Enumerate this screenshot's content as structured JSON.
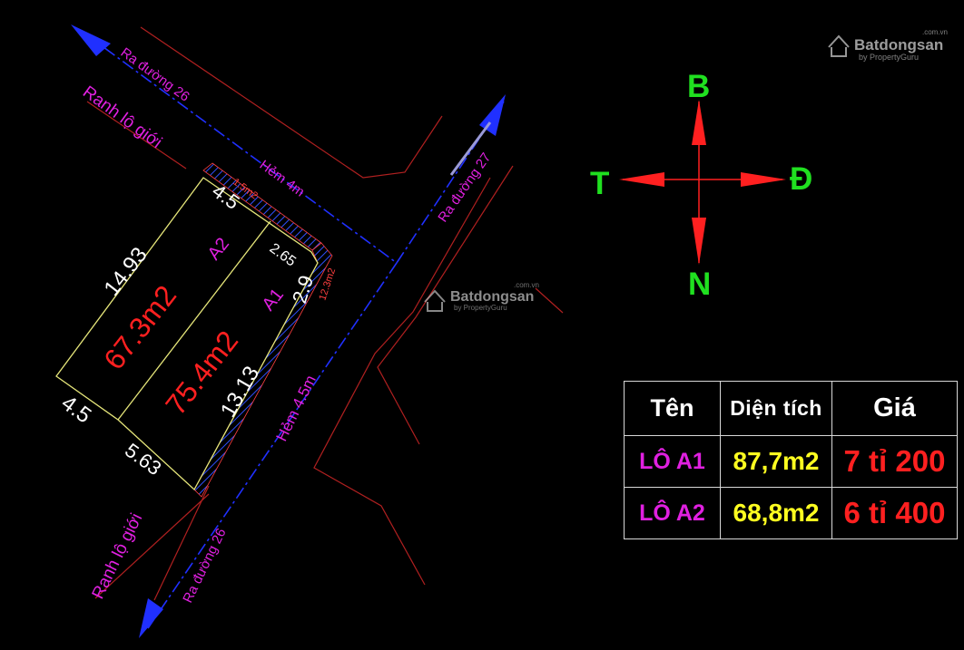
{
  "watermark": {
    "brand": "Batdongsan",
    "domain": ".com.vn",
    "tagline": "by PropertyGuru"
  },
  "compass": {
    "north": "B",
    "south": "N",
    "east": "Đ",
    "west": "T"
  },
  "roads": {
    "road_26_top": "Ra đường 26",
    "road_26_bottom": "Ra đường 26",
    "road_27": "Ra đường 27",
    "alley_4m": "Hẻm 4m",
    "alley_45m": "Hẻm 4.5m",
    "boundary_top": "Ranh lộ giới",
    "boundary_bottom": "Ranh lộ giới"
  },
  "plot": {
    "a2_label": "A2",
    "a2_area": "67.3m2",
    "a1_label": "A1",
    "a1_area": "75.4m2",
    "dim_top": "4.5",
    "dim_left": "14.93",
    "dim_bottom_left": "4.5",
    "dim_bottom": "5.63",
    "dim_right": "13.13",
    "dim_chamfer_a": "2.65",
    "dim_chamfer_b": "2.9",
    "setback_top": "1.5m2",
    "setback_right": "12.3m2"
  },
  "table": {
    "headers": {
      "name": "Tên",
      "area": "Diện tích",
      "price": "Giá"
    },
    "rows": [
      {
        "name": "LÔ A1",
        "area": "87,7m2",
        "price": "7 tỉ 200"
      },
      {
        "name": "LÔ A2",
        "area": "68,8m2",
        "price": "6 tỉ 400"
      }
    ]
  },
  "colors": {
    "blue": "#2030ff",
    "magenta": "#e020e0",
    "red": "#ff2020",
    "green": "#20e020",
    "yellow": "#ffff20",
    "boundary": "#b02020",
    "lot_outline": "#e6e67a"
  }
}
